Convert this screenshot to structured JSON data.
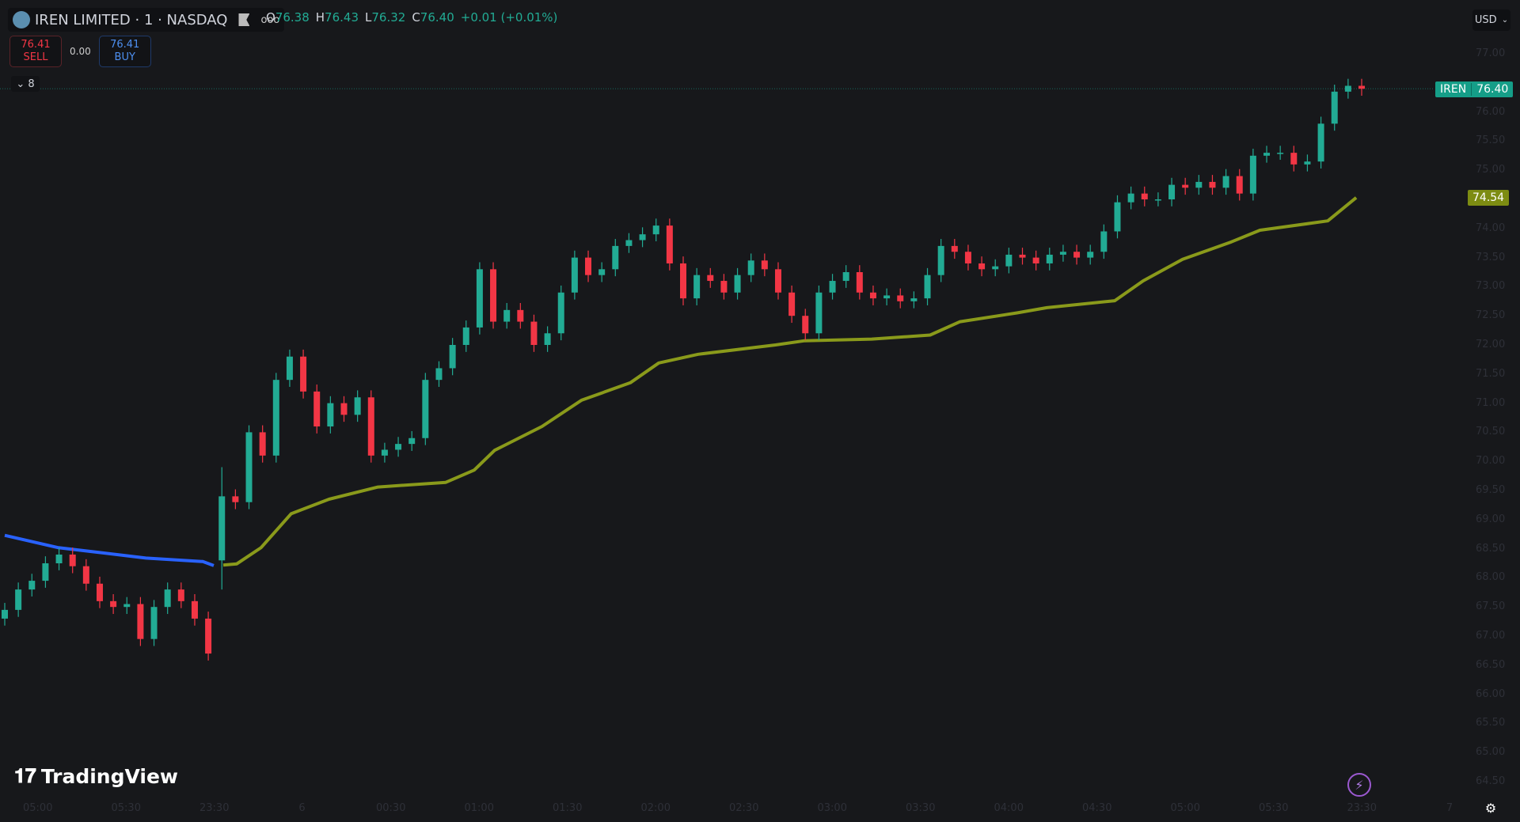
{
  "header": {
    "symbol_title": "IREN LIMITED · 1 · NASDAQ",
    "more_label": "ooo",
    "ohlc": [
      {
        "key": "O",
        "value": "76.38"
      },
      {
        "key": "H",
        "value": "76.43"
      },
      {
        "key": "L",
        "value": "76.32"
      },
      {
        "key": "C",
        "value": "76.40"
      }
    ],
    "change": "+0.01 (+0.01%)"
  },
  "trade": {
    "sell_price": "76.41",
    "sell_label": "SELL",
    "spread": "0.00",
    "buy_price": "76.41",
    "buy_label": "BUY"
  },
  "indicators_count": "8",
  "currency": "USD",
  "price_tags": {
    "symbol": "IREN",
    "last": "76.40",
    "last_value": 76.4,
    "ma": "74.54",
    "ma_value": 74.54
  },
  "brand": "TradingView",
  "colors": {
    "up": "#22ab94",
    "down": "#f23645",
    "ma_prev": "#2962ff",
    "ma_curr": "#8a9a1b",
    "background": "#17181b"
  },
  "chart_data": {
    "type": "candlestick",
    "ylim": [
      64.3,
      77.2
    ],
    "y_ticks": [
      "77.00",
      "76.00",
      "75.50",
      "75.00",
      "74.00",
      "73.50",
      "73.00",
      "72.50",
      "72.00",
      "71.50",
      "71.00",
      "70.50",
      "70.00",
      "69.50",
      "69.00",
      "68.50",
      "68.00",
      "67.50",
      "67.00",
      "66.50",
      "66.00",
      "65.50",
      "65.00",
      "64.50"
    ],
    "x_ticks": [
      "05:00",
      "05:30",
      "23:30",
      "6",
      "00:30",
      "01:00",
      "01:30",
      "02:00",
      "02:30",
      "03:00",
      "03:30",
      "04:00",
      "04:30",
      "05:00",
      "05:30",
      "23:30",
      "7"
    ],
    "first_open": 67.3,
    "gap_open": {
      "index": 16,
      "open": 68.3,
      "high": 69.9,
      "low": 67.8
    },
    "close": [
      67.45,
      67.8,
      67.95,
      68.25,
      68.4,
      68.2,
      67.9,
      67.6,
      67.5,
      67.55,
      66.95,
      67.5,
      67.8,
      67.6,
      67.3,
      66.7,
      69.4,
      69.3,
      70.5,
      70.1,
      71.4,
      71.8,
      71.2,
      70.6,
      71.0,
      70.8,
      71.1,
      70.1,
      70.2,
      70.3,
      70.4,
      71.4,
      71.6,
      72.0,
      72.3,
      73.3,
      72.4,
      72.6,
      72.4,
      72.0,
      72.2,
      72.9,
      73.5,
      73.2,
      73.3,
      73.7,
      73.8,
      73.9,
      74.05,
      73.4,
      72.8,
      73.2,
      73.1,
      72.9,
      73.2,
      73.45,
      73.3,
      72.9,
      72.5,
      72.2,
      72.9,
      73.1,
      73.25,
      72.9,
      72.8,
      72.85,
      72.75,
      72.8,
      73.2,
      73.7,
      73.6,
      73.4,
      73.3,
      73.35,
      73.55,
      73.5,
      73.4,
      73.55,
      73.6,
      73.5,
      73.6,
      73.95,
      74.45,
      74.6,
      74.5,
      74.5,
      74.75,
      74.7,
      74.8,
      74.7,
      74.9,
      74.6,
      75.25,
      75.3,
      75.3,
      75.1,
      75.15,
      75.8,
      76.35,
      76.45,
      76.4
    ],
    "ma_previous_session": [
      [
        0,
        68.73
      ],
      [
        3.9,
        68.52
      ],
      [
        6.8,
        68.44
      ],
      [
        10.4,
        68.34
      ],
      [
        14.6,
        68.28
      ],
      [
        15.4,
        68.21
      ]
    ],
    "ma_current_session": [
      [
        16.1,
        68.22
      ],
      [
        17.1,
        68.24
      ],
      [
        18.9,
        68.52
      ],
      [
        21.1,
        69.1
      ],
      [
        23.9,
        69.35
      ],
      [
        27.5,
        69.56
      ],
      [
        32.5,
        69.64
      ],
      [
        34.6,
        69.85
      ],
      [
        36.1,
        70.19
      ],
      [
        39.6,
        70.6
      ],
      [
        42.5,
        71.05
      ],
      [
        46.1,
        71.35
      ],
      [
        48.2,
        71.69
      ],
      [
        51.1,
        71.84
      ],
      [
        56.8,
        72.0
      ],
      [
        58.9,
        72.07
      ],
      [
        63.9,
        72.1
      ],
      [
        68.2,
        72.17
      ],
      [
        70.4,
        72.4
      ],
      [
        74.6,
        72.55
      ],
      [
        76.8,
        72.64
      ],
      [
        81.8,
        72.76
      ],
      [
        83.9,
        73.1
      ],
      [
        86.8,
        73.47
      ],
      [
        90.4,
        73.77
      ],
      [
        92.5,
        73.97
      ],
      [
        97.5,
        74.13
      ],
      [
        99.6,
        74.53
      ]
    ]
  }
}
